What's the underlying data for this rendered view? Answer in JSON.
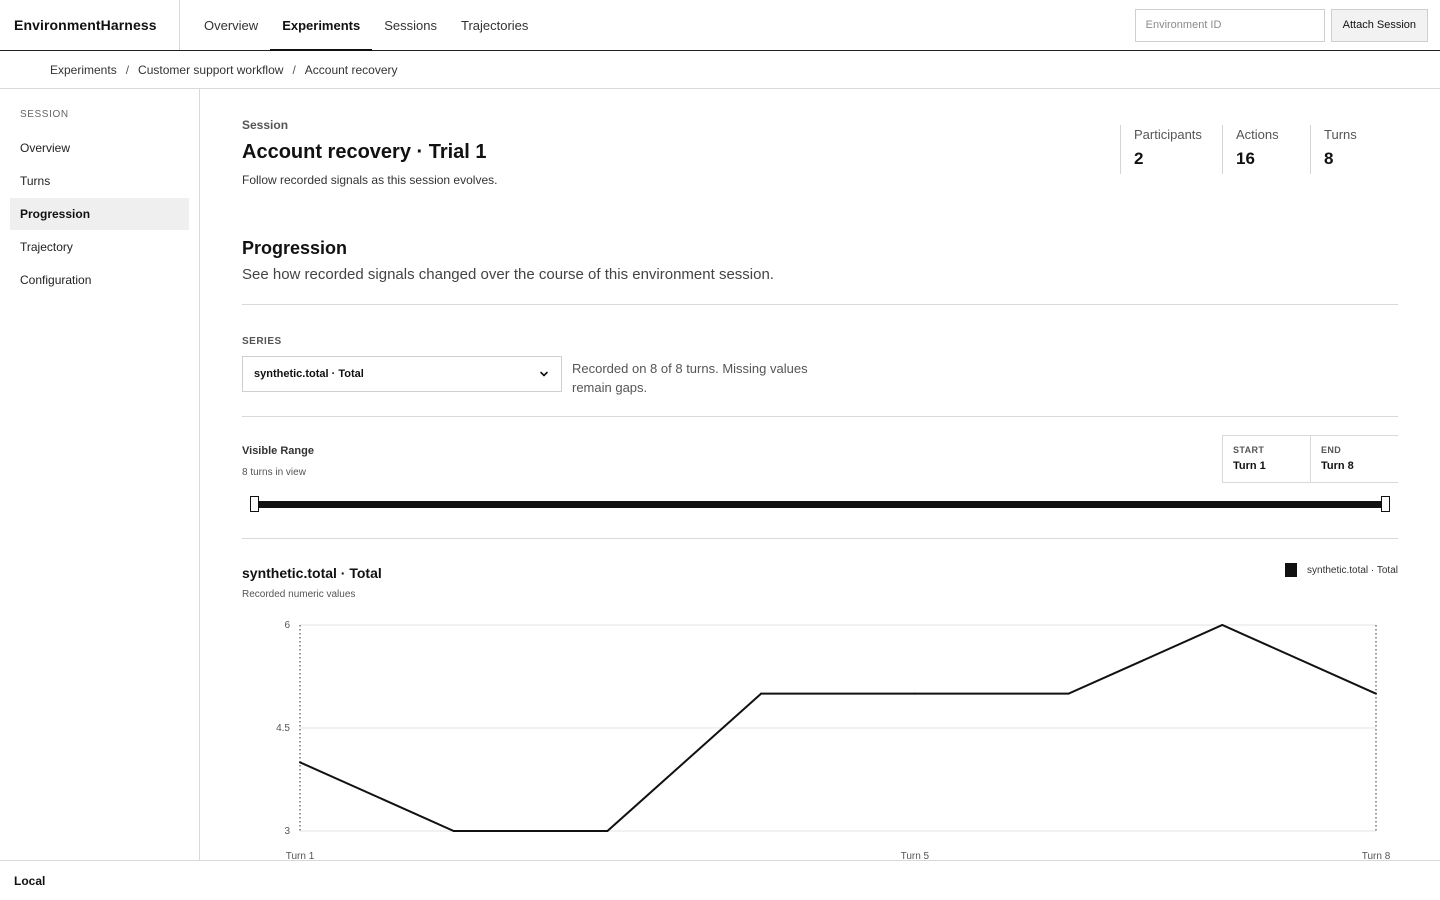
{
  "app": {
    "name": "EnvironmentHarness"
  },
  "topnav": {
    "tabs": [
      {
        "label": "Overview"
      },
      {
        "label": "Experiments"
      },
      {
        "label": "Sessions"
      },
      {
        "label": "Trajectories"
      }
    ],
    "active_tab": "Experiments",
    "env_input": {
      "placeholder": "Environment ID",
      "value": ""
    },
    "attach_label": "Attach Session"
  },
  "breadcrumb": [
    "Experiments",
    "Customer support workflow",
    "Account recovery"
  ],
  "sidebar": {
    "heading": "SESSION",
    "items": [
      {
        "label": "Overview"
      },
      {
        "label": "Turns"
      },
      {
        "label": "Progression"
      },
      {
        "label": "Trajectory"
      },
      {
        "label": "Configuration"
      }
    ],
    "active_item": "Progression"
  },
  "session": {
    "eyebrow": "Session",
    "title": "Account recovery · Trial 1",
    "subtitle": "Follow recorded signals as this session evolves.",
    "stats": [
      {
        "label": "Participants",
        "value": "2"
      },
      {
        "label": "Actions",
        "value": "16"
      },
      {
        "label": "Turns",
        "value": "8"
      }
    ]
  },
  "progression": {
    "title": "Progression",
    "description": "See how recorded signals changed over the course of this environment session.",
    "series_label": "SERIES",
    "series_selected": "synthetic.total · Total",
    "series_note": "Recorded on 8 of 8 turns. Missing values remain gaps.",
    "range": {
      "title": "Visible Range",
      "count": "8 turns in view",
      "start_label": "START",
      "start_value": "Turn 1",
      "end_label": "END",
      "end_value": "Turn 8"
    }
  },
  "chart_data": {
    "type": "line",
    "title": "synthetic.total · Total",
    "subtitle": "Recorded numeric values",
    "x": [
      1,
      2,
      3,
      4,
      5,
      6,
      7,
      8
    ],
    "series": [
      {
        "name": "synthetic.total · Total",
        "values": [
          4,
          3,
          3,
          5,
          5,
          5,
          6,
          5
        ]
      }
    ],
    "ylim": [
      3,
      6
    ],
    "y_ticks": [
      "3",
      "4.5",
      "6"
    ],
    "x_tick_labels": [
      {
        "x": 1,
        "label": "Turn 1"
      },
      {
        "x": 5,
        "label": "Turn 5"
      },
      {
        "x": 8,
        "label": "Turn 8"
      }
    ],
    "grid": true,
    "legend_position": "top-right",
    "line_color": "#111111"
  },
  "footer": {
    "status": "Local"
  }
}
